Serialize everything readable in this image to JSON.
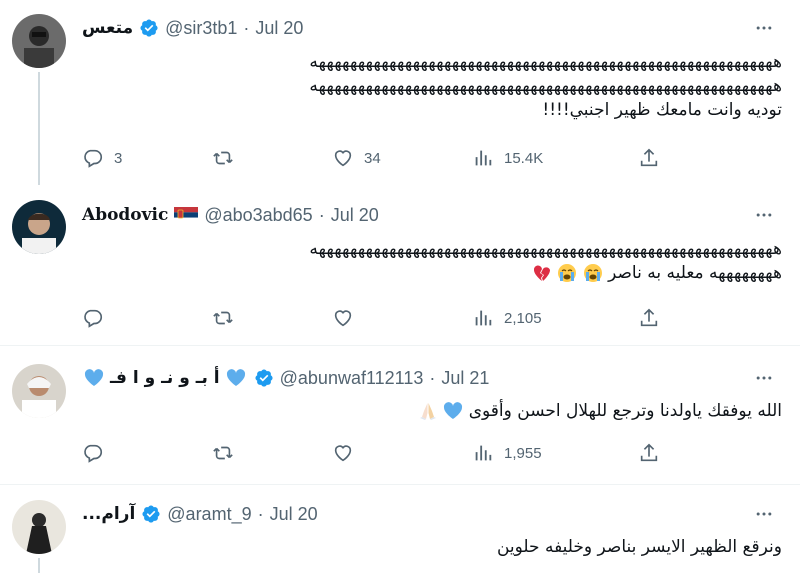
{
  "tweets": [
    {
      "name": "متعس",
      "handle": "@sir3tb1",
      "date": "Jul 20",
      "lines": [
        "هههههههههههههههههههههههههههههههههههههههههههههههههههههههههههه",
        "هههههههههههههههههههههههههههههههههههههههههههههههههههههههههههه",
        "توديه وانت مامعك ظهير اجنبي!!!!"
      ],
      "replies": "3",
      "retweets": "",
      "likes": "34",
      "views": "15.4K"
    },
    {
      "name": "Abodovic",
      "handle": "@abo3abd65",
      "date": "Jul 20",
      "lines": [
        "هههههههههههههههههههههههههههههههههههههههههههههههههههههههههههه",
        "ههههههههه معليه به ناصر"
      ],
      "replies": "",
      "retweets": "",
      "likes": "",
      "views": "2,105"
    },
    {
      "name": "أ بـ و نـ و ا فـ",
      "handle": "@abunwaf112113",
      "date": "Jul 21",
      "lines": [
        "الله يوفقك ياولدنا وترجع للهلال احسن وأقوى"
      ],
      "replies": "",
      "retweets": "",
      "likes": "",
      "views": "1,955"
    },
    {
      "name": "...آرام",
      "handle": "@aramt_9",
      "date": "Jul 20",
      "lines": [
        "ونرقع الظهير الايسر بناصر وخليفه حلوين"
      ]
    }
  ],
  "separator": "·",
  "colors": {
    "verified": "#1d9bf0",
    "secondary": "#536471",
    "thread_line": "#cfd9de"
  },
  "icons": [
    "reply-icon",
    "retweet-icon",
    "like-icon",
    "views-icon",
    "share-icon",
    "more-icon",
    "verified-badge-icon"
  ]
}
